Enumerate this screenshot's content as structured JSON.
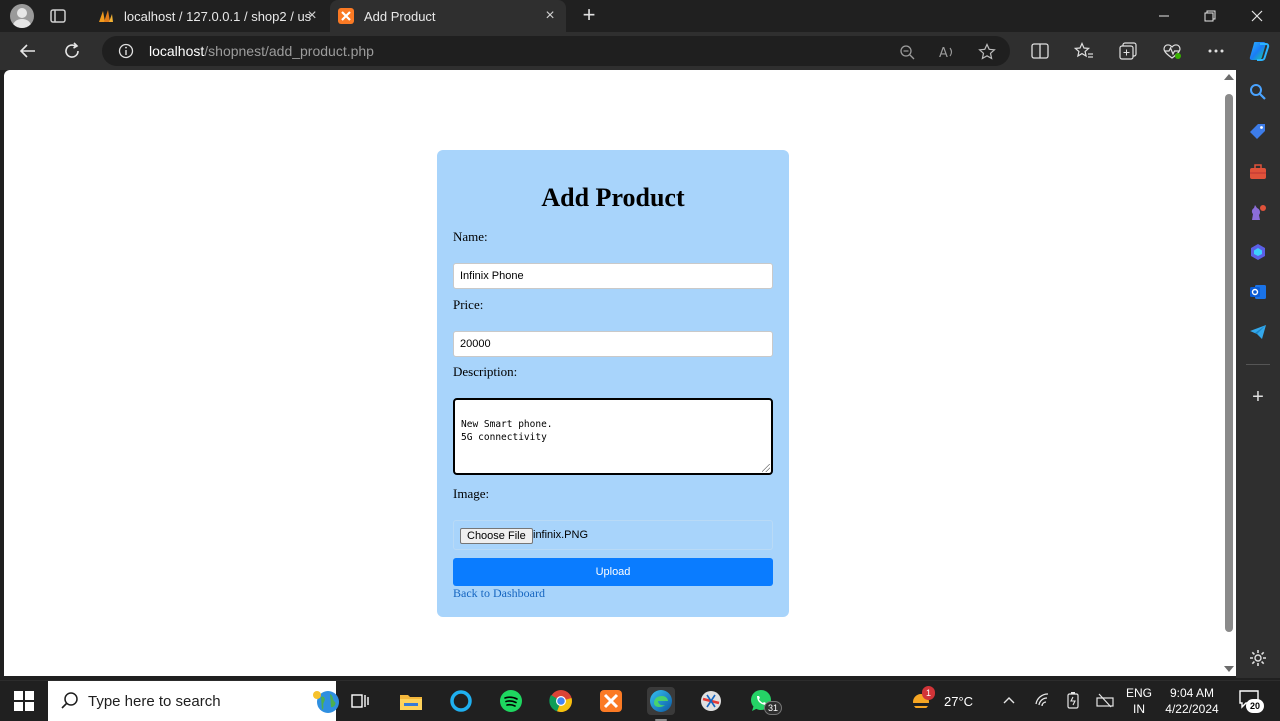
{
  "browser": {
    "tabs": [
      {
        "title": "localhost / 127.0.0.1 / shop2 / us",
        "favicon": "phpmyadmin-icon",
        "active": false
      },
      {
        "title": "Add Product",
        "favicon": "xampp-icon",
        "active": true
      }
    ],
    "url": {
      "host": "localhost",
      "path": "/shopnest/add_product.php"
    }
  },
  "form": {
    "heading": "Add Product",
    "name_label": "Name:",
    "name_value": "Infinix Phone",
    "price_label": "Price:",
    "price_value": "20000",
    "description_label": "Description:",
    "description_value": "New Smart phone.\n5G connectivity",
    "image_label": "Image:",
    "choose_file_label": "Choose File",
    "file_name": "infinix.PNG",
    "upload_label": "Upload",
    "back_link": "Back to Dashboard"
  },
  "colors": {
    "card_background": "#a8d4fb",
    "upload_button": "#0a7cff",
    "link": "#1565c0"
  },
  "taskbar": {
    "search_placeholder": "Type here to search",
    "whatsapp_badge": "31",
    "weather_badge": "1",
    "temperature": "27°C",
    "language": "ENG",
    "region": "IN",
    "time": "9:04 AM",
    "date": "4/22/2024",
    "notification_count": "20"
  }
}
